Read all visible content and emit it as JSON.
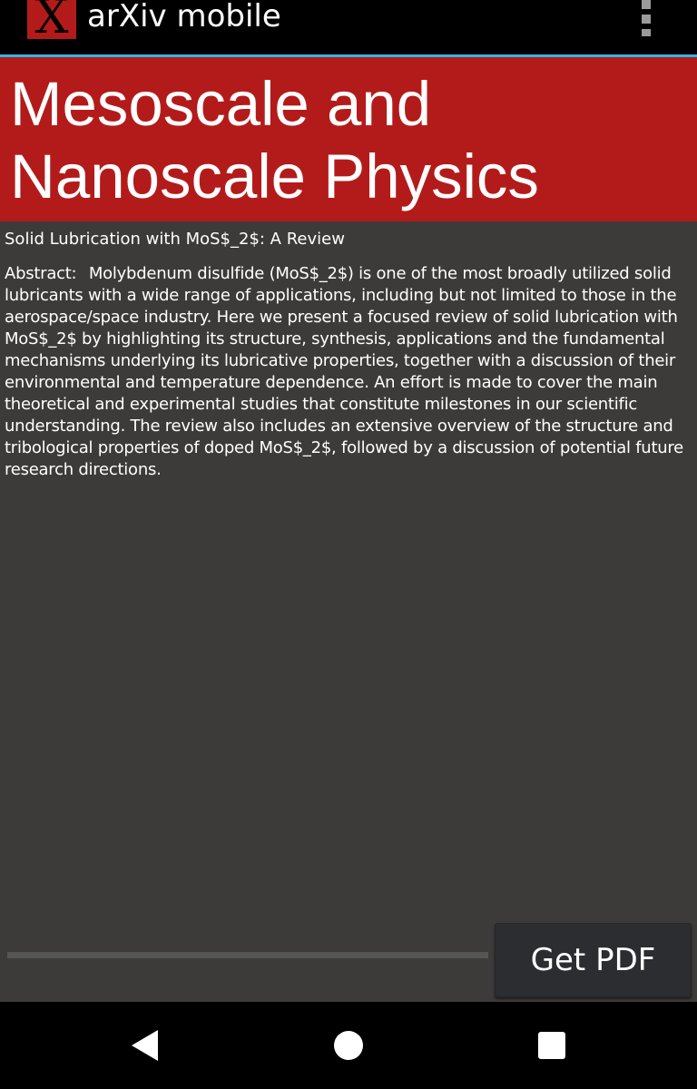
{
  "app": {
    "logo_glyph": "X",
    "title": "arXiv mobile"
  },
  "category": {
    "title": "Mesoscale and Nanoscale Physics"
  },
  "paper": {
    "title": "Solid Lubrication with MoS$_2$: A Review",
    "abstract_label": "Abstract:",
    "abstract_text": "Molybdenum disulfide (MoS$_2$) is one of the most broadly utilized solid lubricants with a wide range of applications, including but not limited to those in the aerospace/space industry. Here we present a focused review of solid lubrication with MoS$_2$ by highlighting its structure, synthesis, applications and the fundamental mechanisms underlying its lubricative properties, together with a discussion of their environmental and temperature dependence. An effort is made to cover the main theoretical and experimental studies that constitute milestones in our scientific understanding. The review also includes an extensive overview of the structure and tribological properties of doped MoS$_2$, followed by a discussion of potential future research directions."
  },
  "download": {
    "progress": 0,
    "button_label": "Get PDF"
  },
  "colors": {
    "accent": "#33b5e5",
    "brand": "#b31b1b",
    "background": "#3c3b39"
  },
  "icons": {
    "menu": "overflow-menu-icon",
    "back": "back-icon",
    "home": "home-icon",
    "recents": "recents-icon"
  }
}
